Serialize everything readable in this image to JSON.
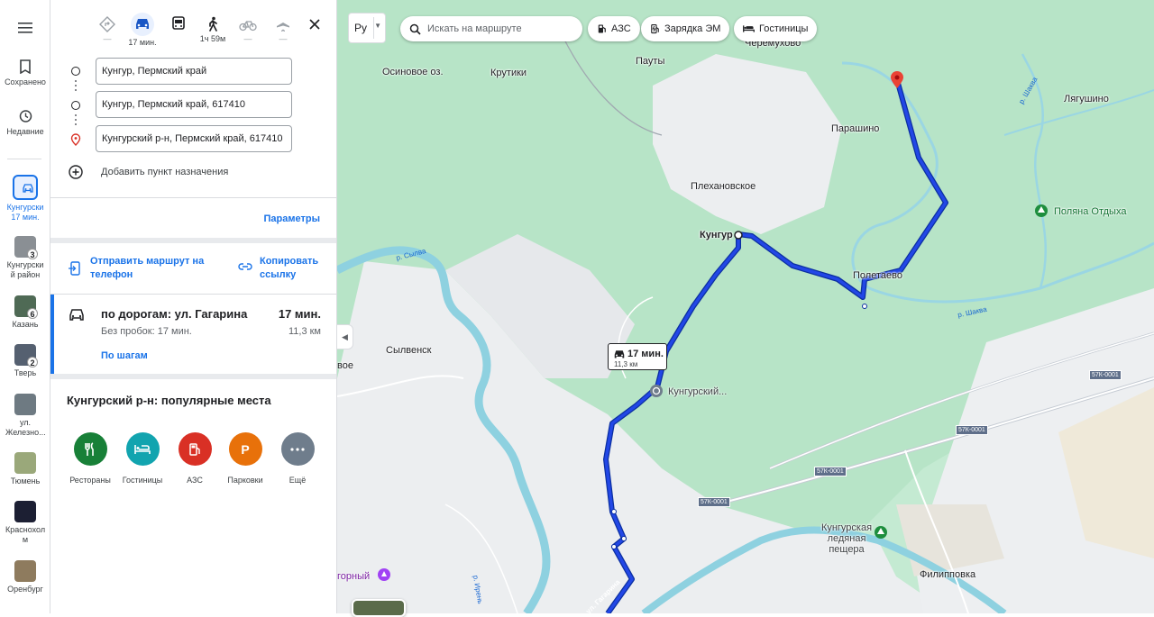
{
  "rail": {
    "menu_icon": "hamburger-menu-icon",
    "saved": "Сохранено",
    "recent": "Недавние",
    "route_item": "Кунгурски 17 мин.",
    "history": [
      {
        "label": "Кунгурски й район",
        "badge": "3"
      },
      {
        "label": "Казань",
        "badge": "6"
      },
      {
        "label": "Тверь",
        "badge": "2"
      },
      {
        "label": "ул. Железно...",
        "badge": ""
      },
      {
        "label": "Тюмень",
        "badge": ""
      },
      {
        "label": "Краснохол м",
        "badge": ""
      },
      {
        "label": "Оренбург",
        "badge": ""
      }
    ]
  },
  "modes": {
    "best": "",
    "car": "17 мин.",
    "transit": "",
    "walk": "1ч 59м",
    "bike": "",
    "flight": "",
    "dash": "—"
  },
  "waypoints": [
    "Кунгур, Пермский край",
    "Кунгур, Пермский край, 617410",
    "Кунгурский р-н, Пермский край, 617410"
  ],
  "add_destination": "Добавить пункт назначения",
  "params": "Параметры",
  "share": {
    "send": "Отправить маршрут на телефон",
    "copy": "Копировать ссылку"
  },
  "route": {
    "title": "по дорогам: ул. Гагарина",
    "time": "17 мин.",
    "sub": "Без пробок: 17 мин.",
    "dist": "11,3 км",
    "steps": "По шагам"
  },
  "popular": {
    "title": "Кунгурский р-н: популярные места",
    "categories": [
      {
        "label": "Рестораны",
        "color": "#188038"
      },
      {
        "label": "Гостиницы",
        "color": "#12a4af"
      },
      {
        "label": "АЗС",
        "color": "#d93025"
      },
      {
        "label": "Парковки",
        "color": "#e8710a"
      },
      {
        "label": "Ещё",
        "color": "#6f7d8c"
      }
    ]
  },
  "map": {
    "lang": "Ру",
    "search_placeholder": "Искать на маршруте",
    "chips": [
      "АЗС",
      "Зарядка ЭМ",
      "Гостиницы"
    ],
    "callout_time": "17 мин.",
    "callout_dist": "11,3 км",
    "labels": {
      "cheremuhovo": "Черемухово",
      "pauty": "Пауты",
      "osinovoe": "Осиновое оз.",
      "krutiki": "Крутики",
      "lyagushino": "Лягушино",
      "parashino": "Парашино",
      "plekhanovskoe": "Плехановское",
      "kungur": "Кунгур",
      "polyana": "Поляна Отдыха",
      "poletaevo": "Полетаево",
      "sylvensk": "Сылвенск",
      "voe": "вое",
      "kungursky": "Кунгурский...",
      "peshchera": "Кунгурская ледяная пещера",
      "filippovka": "Филипповка",
      "gorny": "горный",
      "river_sylva": "р. Сылва",
      "river_shakva": "р. Шаква",
      "river_shakva2": "р. Шаква",
      "river_iren": "р. Ирень",
      "street_gagarina": "ул. Гагарина",
      "roads": [
        "57К-0001",
        "57К-0001",
        "57К-0001",
        "57К-0001"
      ]
    }
  },
  "colors": {
    "route": "#1a3cd1",
    "accent": "#1a73e8",
    "forest": "#b7e4c7",
    "water": "#8ed1e0",
    "urban": "#eceef0"
  }
}
